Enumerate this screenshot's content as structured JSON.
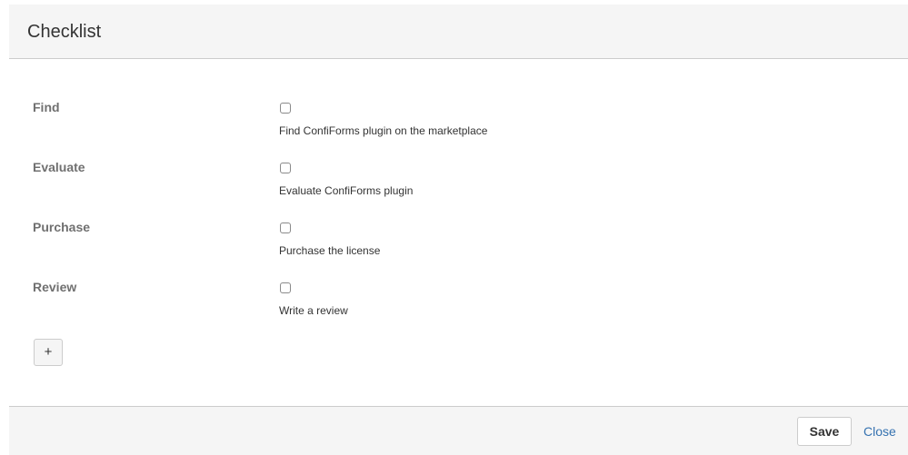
{
  "dialog": {
    "title": "Checklist"
  },
  "fields": [
    {
      "label": "Find",
      "description": "Find ConfiForms plugin on the marketplace",
      "checked": false
    },
    {
      "label": "Evaluate",
      "description": "Evaluate ConfiForms plugin",
      "checked": false
    },
    {
      "label": "Purchase",
      "description": "Purchase the license",
      "checked": false
    },
    {
      "label": "Review",
      "description": "Write a review",
      "checked": false
    }
  ],
  "add_button": {
    "label": "+"
  },
  "footer": {
    "save_label": "Save",
    "close_label": "Close"
  },
  "colors": {
    "header_bg": "#f5f5f5",
    "label_text": "#707070",
    "link": "#3572b0",
    "border": "#cccccc"
  }
}
